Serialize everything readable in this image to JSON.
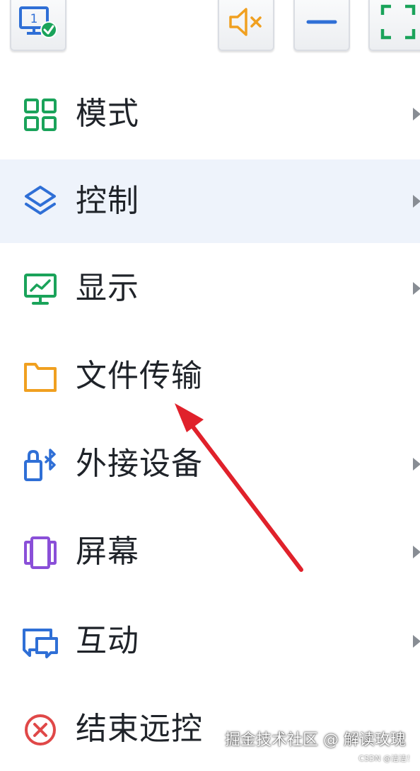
{
  "toolbar": {
    "icons": [
      "monitor-1-connected-icon",
      "speaker-muted-icon",
      "minimize-icon",
      "fullscreen-icon"
    ],
    "monitor_number": "1"
  },
  "menu": {
    "items": [
      {
        "label": "模式",
        "icon": "grid-icon",
        "color": "#1aa35a",
        "has_submenu": true,
        "active": false
      },
      {
        "label": "控制",
        "icon": "layers-icon",
        "color": "#2f6fd6",
        "has_submenu": true,
        "active": true
      },
      {
        "label": "显示",
        "icon": "monitor-chart-icon",
        "color": "#1aa35a",
        "has_submenu": true,
        "active": false
      },
      {
        "label": "文件传输",
        "icon": "folder-icon",
        "color": "#f0a020",
        "has_submenu": false,
        "active": false
      },
      {
        "label": "外接设备",
        "icon": "bluetooth-device-icon",
        "color": "#2f6fd6",
        "has_submenu": true,
        "active": false
      },
      {
        "label": "屏幕",
        "icon": "screens-icon",
        "color": "#8a4fd8",
        "has_submenu": true,
        "active": false
      },
      {
        "label": "互动",
        "icon": "chat-icon",
        "color": "#2f6fd6",
        "has_submenu": true,
        "active": false
      },
      {
        "label": "结束远控",
        "icon": "close-circle-icon",
        "color": "#e04848",
        "has_submenu": false,
        "active": false
      }
    ]
  },
  "annotation": {
    "color": "#e0212b",
    "points_to": "文件传输"
  },
  "watermark": {
    "text": "掘金技术社区 @ 解读玫瑰",
    "csdn": "CSDN @洁洁！"
  }
}
